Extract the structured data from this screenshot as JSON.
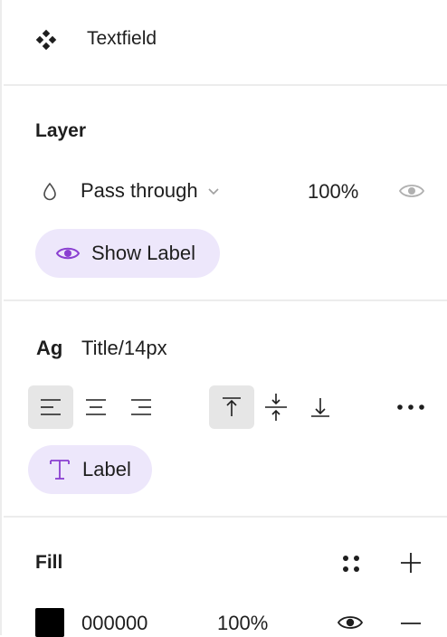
{
  "component": {
    "name": "Textfield",
    "icon": "component-icon"
  },
  "layer": {
    "title": "Layer",
    "blend_mode": "Pass through",
    "opacity": "100%",
    "show_label_button": "Show Label"
  },
  "text": {
    "style_prefix": "Ag",
    "style_name": "Title/14px",
    "align_left_icon": "align-left-icon",
    "align_center_icon": "align-center-icon",
    "align_right_icon": "align-right-icon",
    "align_top_icon": "align-top-icon",
    "align_middle_icon": "align-middle-icon",
    "align_bottom_icon": "align-bottom-icon",
    "more_icon": "more-options-icon",
    "label_button": "Label"
  },
  "fill": {
    "title": "Fill",
    "color_hex": "000000",
    "opacity": "100%",
    "swatch_color": "#000000"
  },
  "colors": {
    "accent_pill": "#ede7fb",
    "accent_icon": "#8a3fd1",
    "active_button": "#e6e6e6",
    "divider": "#ececec"
  }
}
